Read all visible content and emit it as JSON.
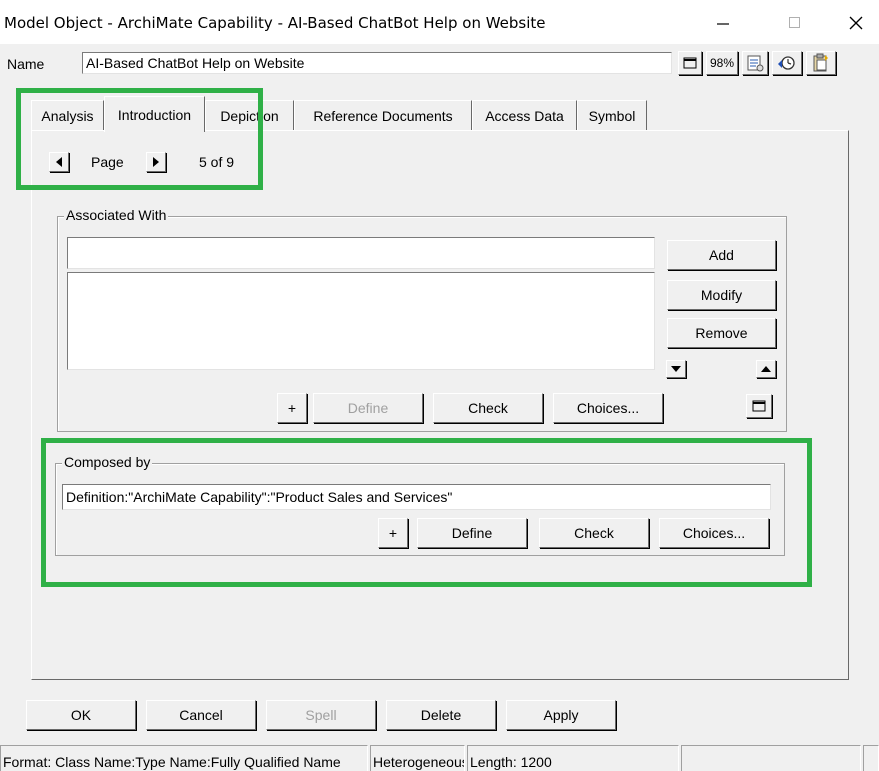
{
  "window": {
    "title": "Model Object - ArchiMate Capability - AI-Based ChatBot Help on Website",
    "minimize_icon": "minimize-icon",
    "maximize_icon": "maximize-icon",
    "close_icon": "close-icon"
  },
  "name_row": {
    "label": "Name",
    "value": "AI-Based ChatBot Help on Website",
    "zoom": "98%",
    "icons": [
      "expand-icon",
      "zoom-icon",
      "properties-icon",
      "history-icon",
      "clipboard-icon"
    ]
  },
  "tabs": [
    {
      "label": "Analysis",
      "active": false
    },
    {
      "label": "Introduction",
      "active": true
    },
    {
      "label": "Depiction",
      "active": false
    },
    {
      "label": "Reference Documents",
      "active": false
    },
    {
      "label": "Access Data",
      "active": false
    },
    {
      "label": "Symbol",
      "active": false
    }
  ],
  "pager": {
    "label": "Page",
    "status": "5 of 9"
  },
  "associated_with": {
    "title": "Associated With",
    "input_value": "",
    "add": "Add",
    "modify": "Modify",
    "remove": "Remove",
    "plus": "+",
    "define": "Define",
    "check": "Check",
    "choices": "Choices..."
  },
  "composed_by": {
    "title": "Composed by",
    "value": "Definition:\"ArchiMate Capability\":\"Product Sales and Services\"",
    "plus": "+",
    "define": "Define",
    "check": "Check",
    "choices": "Choices..."
  },
  "footer": {
    "ok": "OK",
    "cancel": "Cancel",
    "spell": "Spell",
    "delete": "Delete",
    "apply": "Apply"
  },
  "status_bar": {
    "format": "Format: Class Name:Type Name:Fully Qualified Name",
    "type": "Heterogeneous",
    "length": "Length: 1200",
    "cell4": "",
    "cell5": ""
  },
  "colors": {
    "highlight": "#2fb047",
    "face": "#f0f0f0"
  }
}
